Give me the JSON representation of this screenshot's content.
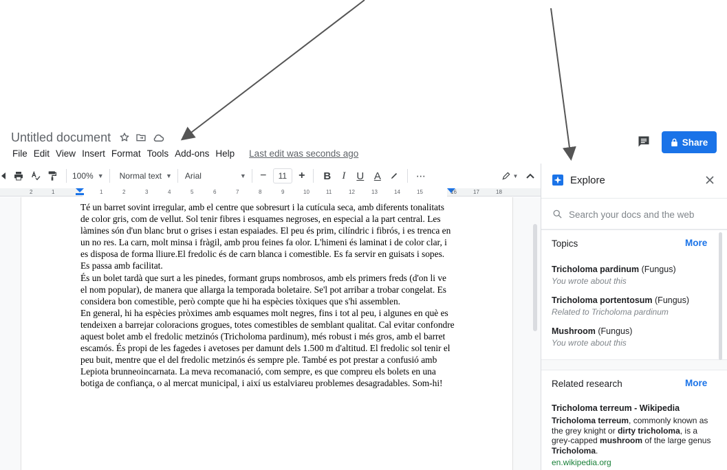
{
  "header": {
    "doc_title": "Untitled document",
    "menu": [
      "File",
      "Edit",
      "View",
      "Insert",
      "Format",
      "Tools",
      "Add-ons",
      "Help"
    ],
    "last_edit": "Last edit was seconds ago",
    "share_label": "Share"
  },
  "toolbar": {
    "zoom": "100%",
    "style": "Normal text",
    "font": "Arial",
    "font_size": "11",
    "bold": "B",
    "italic": "I",
    "underline": "U",
    "text_color": "A",
    "more": "⋯"
  },
  "ruler": {
    "numbers": [
      "2",
      "1",
      "1",
      "2",
      "3",
      "4",
      "5",
      "6",
      "7",
      "8",
      "9",
      "10",
      "11",
      "12",
      "13",
      "14",
      "15",
      "16",
      "17",
      "18"
    ]
  },
  "document": {
    "paragraphs": [
      "Té un barret sovint irregular, amb el centre que sobresurt i la cutícula seca, amb diferents tonalitats de color gris, com de vellut. Sol tenir fibres i esquames negroses, en especial a la part central. Les làmines són d'un blanc brut o grises i estan espaiades. El peu és prim, cilíndric i fibrós, i es trenca en un no res. La carn, molt minsa i fràgil, amb prou feines fa olor. L'himeni és laminat i de color clar, i es disposa de forma lliure.El fredolic és de carn blanca i comestible. Es fa servir en guisats i sopes. Es passa amb facilitat.",
      "És un bolet tardà que surt a les pinedes, formant grups nombrosos, amb els primers freds (d'on li ve el nom popular), de manera que allarga la temporada boletaire. Se'l pot arribar a trobar congelat. Es considera bon comestible, però compte que hi ha espècies tòxiques que s'hi assemblen.",
      "En general, hi ha espècies pròximes amb esquames molt negres, fins i tot al peu, i algunes en què es tendeixen a barrejar coloracions grogues, totes comestibles de semblant qualitat. Cal evitar confondre aquest bolet amb el fredolic metzinós (Tricholoma pardinum), més robust i més gros, amb el barret escamós. És propi de les fagedes i avetoses per damunt dels 1.500 m d'altitud. El fredolic sol tenir el peu buit, mentre que el del fredolic metzinós és sempre ple. També es pot prestar a confusió amb Lepiota brunneoincarnata. La meva recomanació, com sempre, es que compreu els bolets en una botiga de confiança, o al mercat municipal, i així us estalviareu problemes desagradables. Som-hi!"
    ]
  },
  "explore": {
    "title": "Explore",
    "search_placeholder": "Search your docs and the web",
    "topics": {
      "title": "Topics",
      "more": "More",
      "items": [
        {
          "name": "Tricholoma pardinum",
          "type": " (Fungus)",
          "sub": "You wrote about this"
        },
        {
          "name": "Tricholoma portentosum",
          "type": " (Fungus)",
          "sub": "Related to Tricholoma pardinum"
        },
        {
          "name": "Mushroom",
          "type": " (Fungus)",
          "sub": "You wrote about this"
        }
      ]
    },
    "related": {
      "title": "Related research",
      "more": "More",
      "result_title": "Tricholoma terreum - Wikipedia",
      "snippet_parts": [
        {
          "t": "Tricholoma terreum",
          "b": true
        },
        {
          "t": ", commonly known as the grey knight or ",
          "b": false
        },
        {
          "t": "dirty tricholoma",
          "b": true
        },
        {
          "t": ", is a grey-capped ",
          "b": false
        },
        {
          "t": "mushroom",
          "b": true
        },
        {
          "t": " of the large genus ",
          "b": false
        },
        {
          "t": "Tricholoma",
          "b": true
        },
        {
          "t": ".",
          "b": false
        }
      ],
      "source": "en.wikipedia.org"
    }
  },
  "colors": {
    "accent": "#1a73e8",
    "source_green": "#188038",
    "arrow": "#555555"
  }
}
